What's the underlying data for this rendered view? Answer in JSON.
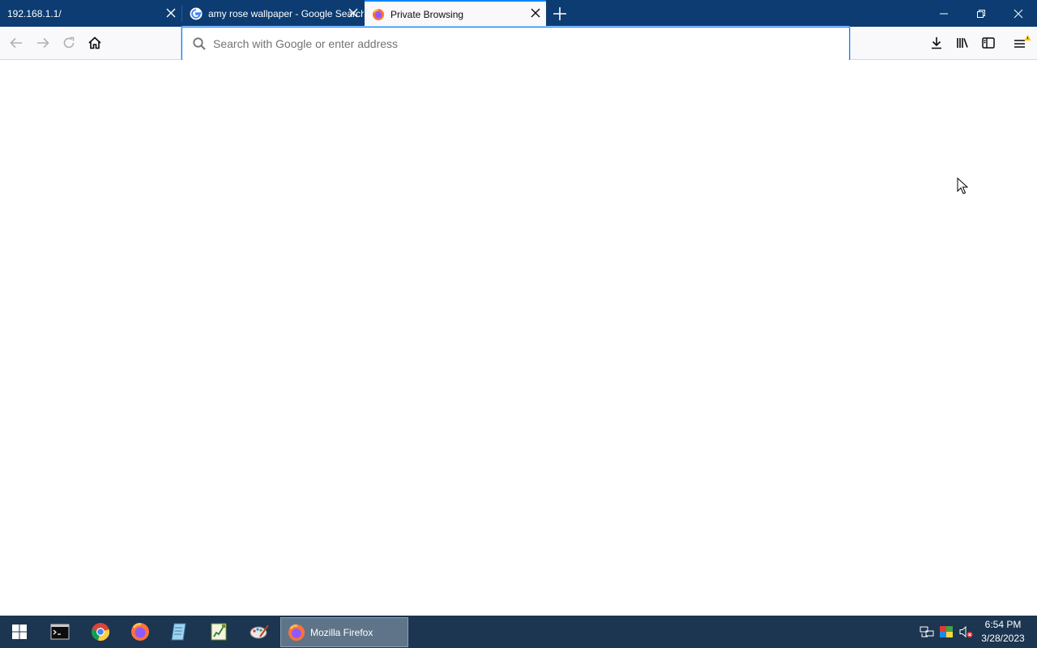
{
  "browser": {
    "tabs": [
      {
        "title": "192.168.1.1/",
        "active": false
      },
      {
        "title": "amy rose wallpaper - Google Search",
        "active": false
      },
      {
        "title": "Private Browsing",
        "active": true
      }
    ],
    "urlbar": {
      "placeholder": "Search with Google or enter address",
      "value": ""
    },
    "colors": {
      "tabstrip": "#0c3c72",
      "accent": "#0a84ff",
      "toolbar": "#f9f9fb"
    }
  },
  "taskbar": {
    "pinned": [
      "start-icon",
      "terminal-icon",
      "chrome-icon",
      "firefox-icon",
      "notepad-icon",
      "spreadsheet-icon",
      "paint-icon"
    ],
    "running_app": {
      "label": "Mozilla Firefox"
    },
    "clock": {
      "time": "6:54 PM",
      "date": "3/28/2023"
    }
  }
}
